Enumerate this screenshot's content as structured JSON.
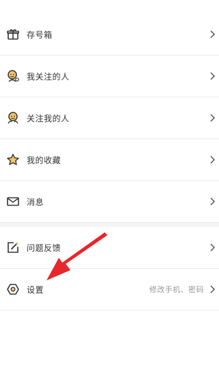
{
  "menu": {
    "items": [
      {
        "label": "存号箱",
        "icon": "gift-icon"
      },
      {
        "label": "我关注的人",
        "icon": "person-follow-icon"
      },
      {
        "label": "关注我的人",
        "icon": "followers-icon"
      },
      {
        "label": "我的收藏",
        "icon": "star-icon"
      },
      {
        "label": "消息",
        "icon": "mail-icon"
      }
    ]
  },
  "menu2": {
    "items": [
      {
        "label": "问题反馈",
        "icon": "feedback-edit-icon"
      },
      {
        "label": "设置",
        "icon": "settings-hexagon-icon",
        "hint": "修改手机、密码"
      }
    ]
  },
  "colors": {
    "icon_stroke": "#333333",
    "icon_fill": "#f5c76b",
    "arrow": "#e8262b"
  }
}
